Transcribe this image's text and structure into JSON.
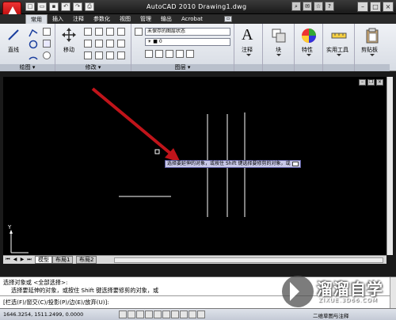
{
  "window": {
    "title": "AutoCAD 2010   Drawing1.dwg"
  },
  "ribbon_tabs": [
    {
      "label": "常用",
      "active": true
    },
    {
      "label": "插入"
    },
    {
      "label": "注释"
    },
    {
      "label": "参数化"
    },
    {
      "label": "视图"
    },
    {
      "label": "管理"
    },
    {
      "label": "输出"
    },
    {
      "label": "Acrobat"
    }
  ],
  "ribbon": {
    "draw": {
      "title": "绘图",
      "line_label": "直线"
    },
    "modify": {
      "title": "修改",
      "move_label": "移动"
    },
    "layers": {
      "title": "图层",
      "layer_state": "未保存的图层状态",
      "current_layer": "0"
    },
    "annotation": {
      "label": "注释"
    },
    "block": {
      "label": "块"
    },
    "properties": {
      "label": "特性"
    },
    "utilities": {
      "label": "实用工具"
    },
    "clipboard": {
      "label": "剪贴板"
    }
  },
  "canvas": {
    "prompt": "选择要延伸的对象，或按住 Shift 键选择要修剪的对象，或",
    "ucs_y": "Y"
  },
  "layout_tabs": [
    {
      "label": "模型",
      "active": true
    },
    {
      "label": "布局1"
    },
    {
      "label": "布局2"
    }
  ],
  "command": {
    "line1": "选择对象或 <全部选择>:",
    "line2": "选择要延伸的对象，或按住 Shift 键选择要修剪的对象，或",
    "line3": "[栏选(F)/窗交(C)/投影(P)/边(E)/放弃(U)]:"
  },
  "status": {
    "coords": "1646.3254, 1511.2499, 0.0000",
    "workspace": "二维草图与注释"
  },
  "watermark": {
    "name": "溜溜自学",
    "url": "ZIXUE.3D66.COM"
  },
  "colors": {
    "arrow": "#c0141a",
    "canvas_bg": "#000000",
    "prompt_bg": "#c8c8e8"
  }
}
